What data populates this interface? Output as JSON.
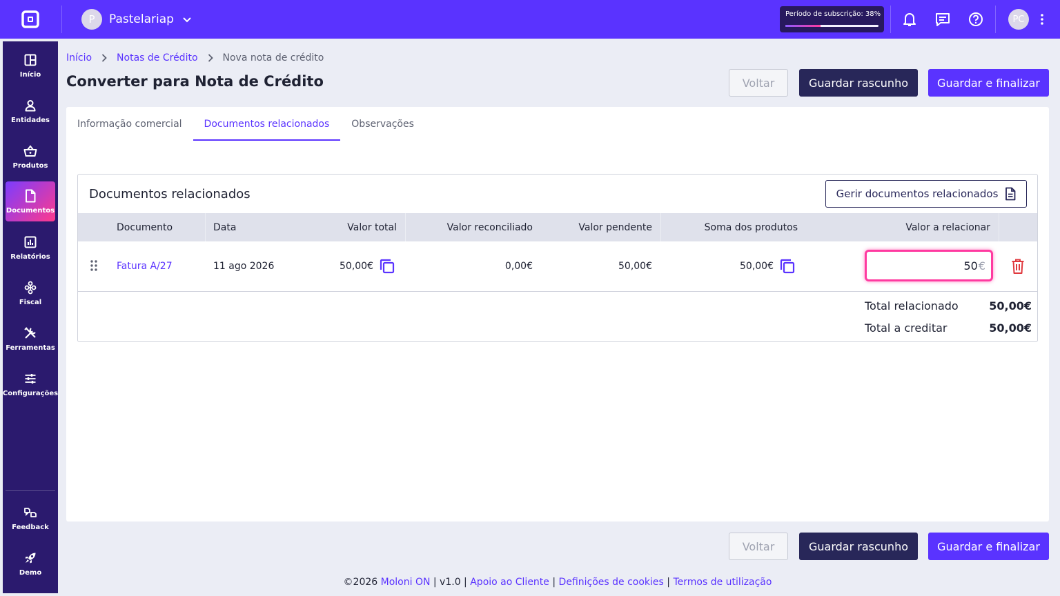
{
  "topbar": {
    "company_initial": "P",
    "company_name": "Pastelariap",
    "subscription_text": "Período de subscrição: 38%",
    "subscription_progress": 0.38,
    "user_initials": "PC"
  },
  "sidebar": {
    "items": [
      {
        "label": "Início",
        "icon": "grid-icon"
      },
      {
        "label": "Entidades",
        "icon": "user-icon"
      },
      {
        "label": "Produtos",
        "icon": "basket-icon"
      },
      {
        "label": "Documentos",
        "icon": "document-icon"
      },
      {
        "label": "Relatórios",
        "icon": "chart-icon"
      },
      {
        "label": "Fiscal",
        "icon": "fiscal-icon"
      },
      {
        "label": "Ferramentas",
        "icon": "tools-icon"
      },
      {
        "label": "Configurações",
        "icon": "sliders-icon"
      },
      {
        "label": "Feedback",
        "icon": "feedback-icon"
      },
      {
        "label": "Demo",
        "icon": "rocket-icon"
      }
    ]
  },
  "breadcrumb": {
    "home": "Início",
    "section": "Notas de Crédito",
    "current": "Nova nota de crédito"
  },
  "page": {
    "title": "Converter para Nota de Crédito"
  },
  "actions": {
    "back": "Voltar",
    "draft": "Guardar rascunho",
    "finalize": "Guardar e finalizar"
  },
  "tabs": [
    {
      "label": "Informação comercial"
    },
    {
      "label": "Documentos relacionados"
    },
    {
      "label": "Observações"
    }
  ],
  "related": {
    "title": "Documentos relacionados",
    "manage_button": "Gerir documentos relacionados",
    "columns": [
      "Documento",
      "Data",
      "Valor total",
      "Valor reconciliado",
      "Valor pendente",
      "Soma dos produtos",
      "Valor a relacionar"
    ],
    "rows": [
      {
        "document": "Fatura A/27",
        "date": "11 ago 2026",
        "total": "50,00€",
        "reconciled": "0,00€",
        "pending": "50,00€",
        "products_sum": "50,00€",
        "to_relate": "50",
        "currency": "€"
      }
    ],
    "totals": {
      "related_label": "Total relacionado",
      "related_value": "50,00€",
      "credit_label": "Total a creditar",
      "credit_value": "50,00€"
    }
  },
  "footer": {
    "copyright": "©2026 ",
    "brand": "Moloni ON",
    "version": " | v1.0 | ",
    "support": "Apoio ao Cliente",
    "sep1": " | ",
    "cookies": "Definições de cookies",
    "sep2": " | ",
    "terms": "Termos de utilização"
  }
}
